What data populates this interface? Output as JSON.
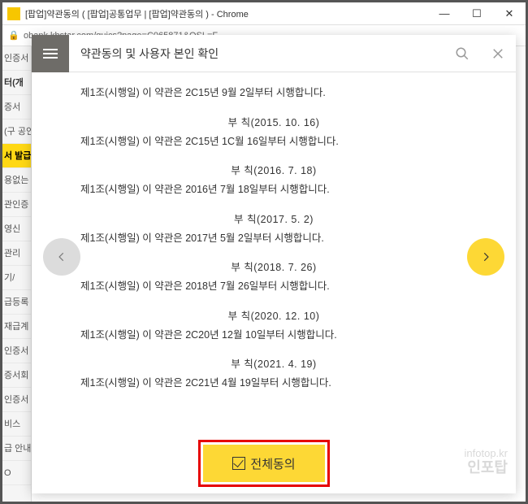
{
  "window": {
    "title": "[팝업]약관동의 ( [팝업]공통업무 | [팝업]약관동의 ) - Chrome",
    "url": "obank.kbstar.com/quics?page=C065871&QSL=F"
  },
  "bg_sidebar": {
    "header": "인증서",
    "title": "터(개",
    "items": [
      "증서",
      "(구 공인",
      "서 발급",
      "용없는",
      "관인증",
      "영신",
      "관리",
      "기/",
      "급등록",
      "재급계",
      "인증서",
      "증서회",
      "인증서",
      "비스",
      "급 안내",
      "O"
    ]
  },
  "popup": {
    "title": "약관동의 및 사용자 본인 확인"
  },
  "content": {
    "first_line": "제1조(시행일) 이 약관은 2C15년 9월 2일부터 시행합니다.",
    "addenda": [
      {
        "head": "부 칙(2015. 10. 16)",
        "body": "제1조(시행일) 이 약관은 2C15년 1C월 16일부터 시행합니다."
      },
      {
        "head": "부 칙(2016. 7. 18)",
        "body": "제1조(시행일) 이 약관은 2016년 7월 18일부터 시행합니다."
      },
      {
        "head": "부 칙(2017. 5. 2)",
        "body": "제1조(시행일) 이 약관은 2017년 5월 2일부터 시행합니다."
      },
      {
        "head": "부 칙(2018. 7. 26)",
        "body": "제1조(시행일) 이 약관은 2018년 7월 26일부터 시행합니다."
      },
      {
        "head": "부 칙(2020. 12. 10)",
        "body": "제1조(시행일) 이 약관은 2C20년 12월 10일부터 시행합니다."
      },
      {
        "head": "부 칙(2021. 4. 19)",
        "body": "제1조(시행일) 이 약관은 2C21년 4월 19일부터 시행합니다."
      }
    ]
  },
  "agree_button": "전체동의",
  "watermark": {
    "small": "infotop.kr",
    "big": "인포탑"
  },
  "bg_sidebar_highlight_index": 2
}
